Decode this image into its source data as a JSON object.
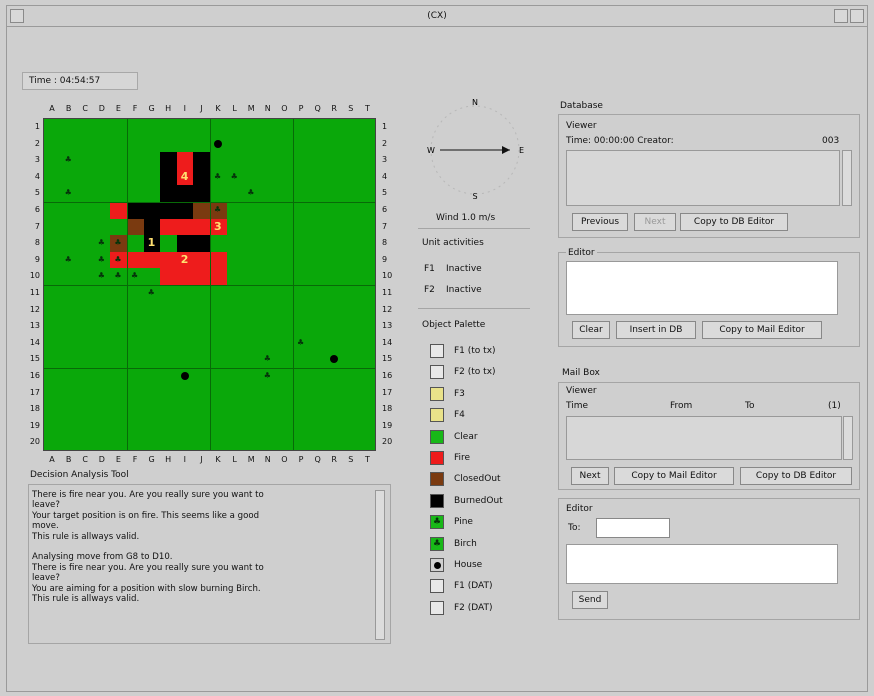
{
  "window": {
    "title": "(CX)"
  },
  "time_label": "Time : 04:54:57",
  "grid": {
    "columns": [
      "A",
      "B",
      "C",
      "D",
      "E",
      "F",
      "G",
      "H",
      "I",
      "J",
      "K",
      "L",
      "M",
      "N",
      "O",
      "P",
      "Q",
      "R",
      "S",
      "T"
    ],
    "rows": [
      "1",
      "2",
      "3",
      "4",
      "5",
      "6",
      "7",
      "8",
      "9",
      "10",
      "11",
      "12",
      "13",
      "14",
      "15",
      "16",
      "17",
      "18",
      "19",
      "20"
    ],
    "cells": {
      "fire": [
        [
          8,
          3
        ],
        [
          8,
          4
        ],
        [
          7,
          7
        ],
        [
          8,
          7
        ],
        [
          9,
          7
        ],
        [
          10,
          7
        ],
        [
          4,
          9
        ],
        [
          5,
          9
        ],
        [
          6,
          9
        ],
        [
          7,
          9
        ],
        [
          8,
          9
        ],
        [
          9,
          9
        ],
        [
          10,
          9
        ],
        [
          7,
          10
        ],
        [
          8,
          10
        ],
        [
          9,
          10
        ],
        [
          10,
          10
        ],
        [
          4,
          6
        ]
      ],
      "burned": [
        [
          7,
          3
        ],
        [
          9,
          3
        ],
        [
          7,
          4
        ],
        [
          9,
          4
        ],
        [
          7,
          5
        ],
        [
          8,
          5
        ],
        [
          9,
          5
        ],
        [
          7,
          6
        ],
        [
          8,
          6
        ],
        [
          9,
          6
        ],
        [
          5,
          6
        ],
        [
          6,
          6
        ],
        [
          5,
          7
        ],
        [
          6,
          7
        ],
        [
          9,
          8
        ],
        [
          6,
          8
        ],
        [
          8,
          8
        ]
      ],
      "closed": [
        [
          10,
          6
        ],
        [
          4,
          8
        ],
        [
          5,
          7
        ],
        [
          9,
          6
        ]
      ]
    },
    "trees_pine": [
      [
        1,
        3
      ],
      [
        1,
        5
      ],
      [
        10,
        4
      ],
      [
        11,
        4
      ],
      [
        12,
        5
      ],
      [
        10,
        6
      ],
      [
        1,
        9
      ],
      [
        3,
        8
      ],
      [
        4,
        8
      ],
      [
        3,
        9
      ],
      [
        4,
        9
      ],
      [
        3,
        10
      ],
      [
        4,
        10
      ],
      [
        5,
        10
      ],
      [
        6,
        11
      ],
      [
        15,
        14
      ],
      [
        13,
        15
      ],
      [
        13,
        16
      ]
    ],
    "houses": [
      [
        10,
        2
      ],
      [
        17,
        15
      ],
      [
        8,
        16
      ]
    ],
    "units": [
      {
        "label": "1",
        "col": 6,
        "row": 8
      },
      {
        "label": "2",
        "col": 8,
        "row": 9
      },
      {
        "label": "3",
        "col": 10,
        "row": 7
      },
      {
        "label": "4",
        "col": 8,
        "row": 4
      }
    ]
  },
  "compass": {
    "n": "N",
    "s": "S",
    "e": "E",
    "w": "W",
    "wind": "Wind 1.0 m/s"
  },
  "unit_activities": {
    "title": "Unit activities",
    "items": [
      {
        "unit": "F1",
        "status": "Inactive"
      },
      {
        "unit": "F2",
        "status": "Inactive"
      }
    ]
  },
  "palette": {
    "title": "Object Palette",
    "items": [
      {
        "label": "F1 (to tx)",
        "color": "#e8e8e8"
      },
      {
        "label": "F2 (to tx)",
        "color": "#e8e8e8"
      },
      {
        "label": "F3",
        "color": "#e9e28a"
      },
      {
        "label": "F4",
        "color": "#e9e28a"
      },
      {
        "label": "Clear",
        "color": "#18b818"
      },
      {
        "label": "Fire",
        "color": "#ee1c1c"
      },
      {
        "label": "ClosedOut",
        "color": "#7a3a10"
      },
      {
        "label": "BurnedOut",
        "color": "#000000"
      },
      {
        "label": "Pine",
        "color": "#18b818"
      },
      {
        "label": "Birch",
        "color": "#18b818"
      },
      {
        "label": "House",
        "color": "#d0d0d0"
      },
      {
        "label": "F1 (DAT)",
        "color": "#e8e8e8"
      },
      {
        "label": "F2 (DAT)",
        "color": "#e8e8e8"
      }
    ]
  },
  "decision": {
    "title": "Decision Analysis Tool",
    "text": "There is fire near you. Are you really sure you want to\nleave?\nYour target position is on fire. This seems like a good\nmove.\nThis rule is allways valid.\n\nAnalysing move from G8 to D10.\nThere is fire near you. Are you really sure you want to\nleave?\nYou are aiming for a position with slow burning Birch.\nThis rule is allways valid."
  },
  "database": {
    "title": "Database",
    "viewer_title": "Viewer",
    "viewer_time": "Time: 00:00:00  Creator:",
    "viewer_id": "003",
    "prev_label": "Previous",
    "next_label": "Next",
    "copy_db_label": "Copy to DB Editor",
    "editor_title": "Editor",
    "editor_text": "",
    "clear_label": "Clear",
    "insert_label": "Insert in DB",
    "copy_mail_label": "Copy to Mail Editor"
  },
  "mailbox": {
    "title": "Mail Box",
    "viewer_title": "Viewer",
    "col_time": "Time",
    "col_from": "From",
    "col_to": "To",
    "col_id": "(1)",
    "next_label": "Next",
    "copy_mail_label": "Copy to Mail Editor",
    "copy_db_label": "Copy to DB Editor",
    "editor_title": "Editor",
    "to_label": "To:",
    "to_value": "",
    "body_value": "",
    "send_label": "Send"
  }
}
